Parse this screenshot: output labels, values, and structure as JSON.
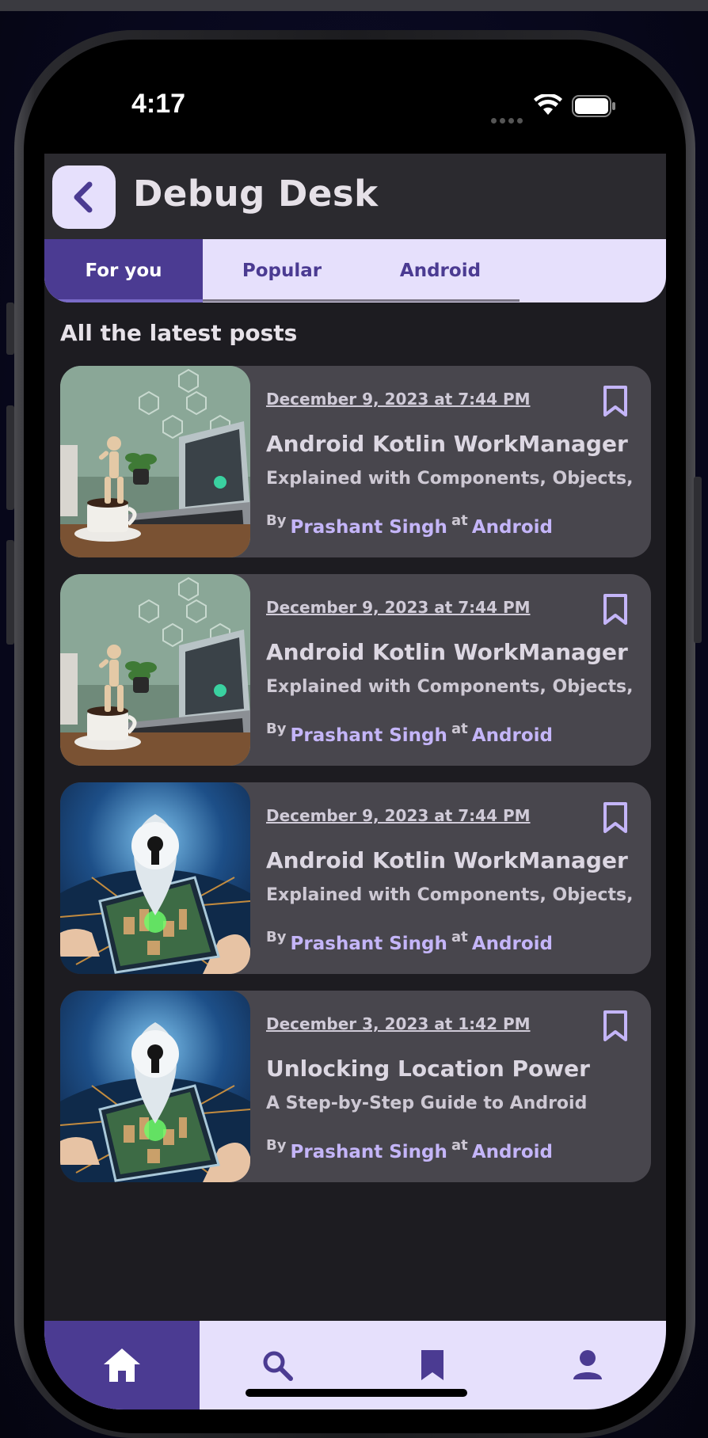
{
  "status_bar": {
    "time": "4:17"
  },
  "app_bar": {
    "title": "Debug Desk",
    "back_icon": "chevron-left-icon"
  },
  "tabs": [
    {
      "label": "For you",
      "active": true
    },
    {
      "label": "Popular",
      "active": false
    },
    {
      "label": "Android",
      "active": false
    }
  ],
  "section_title": "All the latest posts",
  "posts": [
    {
      "date": "December 9, 2023 at 7:44 PM",
      "title": "Android Kotlin WorkManager",
      "subtitle": "Explained with Components, Objects,",
      "by_label": "By",
      "author": "Prashant Singh",
      "at_label": "at",
      "category": "Android",
      "thumbnail": "laptop-desk-image"
    },
    {
      "date": "December 9, 2023 at 7:44 PM",
      "title": "Android Kotlin WorkManager",
      "subtitle": "Explained with Components, Objects,",
      "by_label": "By",
      "author": "Prashant Singh",
      "at_label": "at",
      "category": "Android",
      "thumbnail": "laptop-desk-image"
    },
    {
      "date": "December 9, 2023 at 7:44 PM",
      "title": "Android Kotlin WorkManager",
      "subtitle": "Explained with Components, Objects,",
      "by_label": "By",
      "author": "Prashant Singh",
      "at_label": "at",
      "category": "Android",
      "thumbnail": "location-pin-phone-image"
    },
    {
      "date": "December 3, 2023 at 1:42 PM",
      "title": "Unlocking Location Power",
      "subtitle": "A Step-by-Step Guide to Android",
      "by_label": "By",
      "author": "Prashant Singh",
      "at_label": "at",
      "category": "Android",
      "thumbnail": "location-pin-phone-image"
    }
  ],
  "bottom_nav": [
    {
      "icon": "home-icon",
      "active": true
    },
    {
      "icon": "search-icon",
      "active": false
    },
    {
      "icon": "bookmark-icon",
      "active": false
    },
    {
      "icon": "person-icon",
      "active": false
    }
  ],
  "colors": {
    "primary": "#4b3b92",
    "primary_container": "#e6e0fc",
    "surface": "#1d1c21",
    "card": "#48464d",
    "link": "#c4b5f8"
  }
}
